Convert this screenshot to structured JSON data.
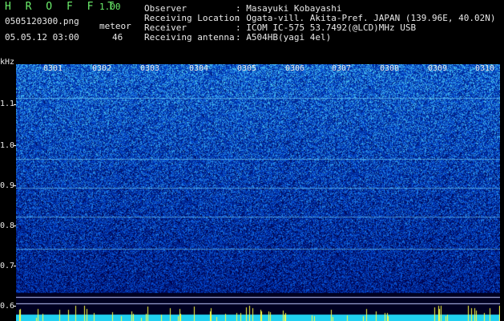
{
  "app": {
    "title": "H R O F F T",
    "version": "1.00"
  },
  "file": {
    "name": "0505120300.png",
    "datetime": "05.05.12 03:00"
  },
  "meteor": {
    "label": "meteor",
    "count": "46"
  },
  "station": {
    "rows": [
      {
        "key": "Observer",
        "value": ": Masayuki Kobayashi"
      },
      {
        "key": "Receiving Location",
        "value": ": Ogata-vill. Akita-Pref. JAPAN (139.96E, 40.02N)"
      },
      {
        "key": "Receiver",
        "value": ": ICOM IC-575 53.7492(@LCD)MHz USB"
      },
      {
        "key": "Receiving antenna",
        "value": ": A504HB(yagi 4el)"
      }
    ]
  },
  "spectrogram": {
    "y_unit": "kHz",
    "y_ticks": [
      "1.1",
      "1.0",
      "0.9",
      "0.8",
      "0.7",
      "0.6"
    ],
    "x_ticks": [
      "0301",
      "0302",
      "0303",
      "0304",
      "0305",
      "0306",
      "0307",
      "0308",
      "0309",
      "0310"
    ],
    "colors": {
      "low": "#000060",
      "mid": "#1a4cff",
      "high": "#40e0ff",
      "marker": "#ffff40"
    }
  }
}
